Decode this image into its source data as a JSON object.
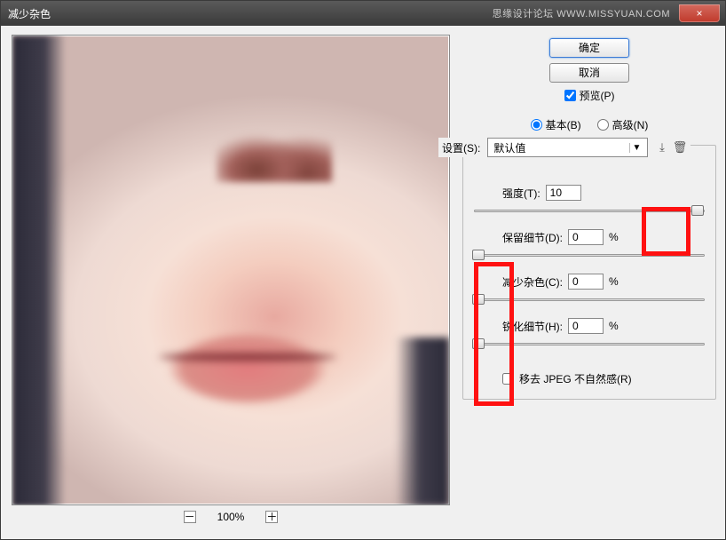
{
  "titlebar": {
    "title": "减少杂色",
    "watermark": "思缘设计论坛  WWW.MISSYUAN.COM",
    "close": "×"
  },
  "zoom": {
    "minus": "－",
    "level": "100%",
    "plus": "＋"
  },
  "buttons": {
    "ok": "确定",
    "cancel": "取消"
  },
  "preview_check": {
    "label": "预览(P)"
  },
  "mode": {
    "basic": "基本(B)",
    "advanced": "高级(N)"
  },
  "settings": {
    "label": "设置(S):",
    "value": "默认值",
    "save_icon": "⤓",
    "delete_icon": "🗑"
  },
  "params": {
    "strength": {
      "label": "强度(T):",
      "value": "10",
      "suffix": "",
      "pos": 97
    },
    "preserve": {
      "label": "保留细节(D):",
      "value": "0",
      "suffix": "%",
      "pos": 2
    },
    "reduce_color": {
      "label": "减少杂色(C):",
      "value": "0",
      "suffix": "%",
      "pos": 2
    },
    "sharpen": {
      "label": "锐化细节(H):",
      "value": "0",
      "suffix": "%",
      "pos": 2
    }
  },
  "jpeg": {
    "label": "移去 JPEG 不自然感(R)"
  }
}
